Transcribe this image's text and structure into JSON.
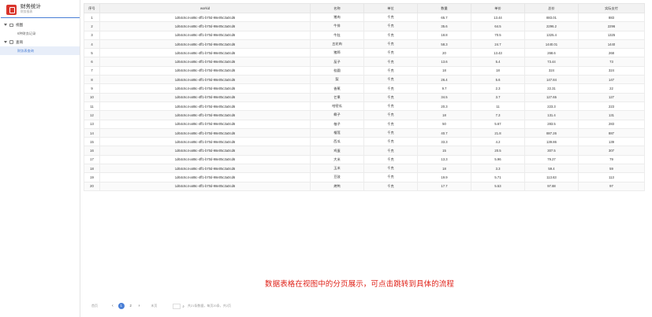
{
  "app": {
    "title": "财务统计",
    "subtitle": "财务报表"
  },
  "sidebar": {
    "items": [
      {
        "label": "视图",
        "level": 1
      },
      {
        "label": "6种财务记录",
        "level": 2
      },
      {
        "label": "查询",
        "level": 1
      },
      {
        "label": "财务表查询",
        "level": 2,
        "active": true
      }
    ]
  },
  "table": {
    "headers": [
      "序号",
      "workid",
      "名称",
      "单位",
      "数量",
      "单价",
      "总价",
      "实际支付"
    ],
    "rows": [
      [
        "1",
        "1d64c6c4-a88c-4ff1-b70d-98e05c3a0cd6",
        "猪肉",
        "千克",
        "65.7",
        "13.44",
        "883.01",
        "883"
      ],
      [
        "2",
        "1d64c6c4-a88c-4ff1-b70d-98e05c3a0cd6",
        "牛排",
        "千克",
        "35.6",
        "64.5",
        "2296.2",
        "2296"
      ],
      [
        "3",
        "1d64c6c4-a88c-4ff1-b70d-98e05c3a0cd6",
        "牛肚",
        "千克",
        "18.8",
        "70.5",
        "1325.4",
        "1325"
      ],
      [
        "4",
        "1d64c6c4-a88c-4ff1-b70d-98e05c3a0cd6",
        "五花肉",
        "千克",
        "58.3",
        "24.7",
        "1440.01",
        "1440"
      ],
      [
        "5",
        "1d64c6c4-a88c-4ff1-b70d-98e05c3a0cd6",
        "猪蹄",
        "千克",
        "20",
        "13.43",
        "268.6",
        "268"
      ],
      [
        "6",
        "1d64c6c4-a88c-4ff1-b70d-98e05c3a0cd6",
        "茄子",
        "千克",
        "13.6",
        "5.4",
        "73.44",
        "73"
      ],
      [
        "7",
        "1d64c6c4-a88c-4ff1-b70d-98e05c3a0cd6",
        "桂圆",
        "千克",
        "18",
        "18",
        "324",
        "324"
      ],
      [
        "8",
        "1d64c6c4-a88c-4ff1-b70d-98e05c3a0cd6",
        "梨",
        "千克",
        "26.4",
        "5.6",
        "147.84",
        "147"
      ],
      [
        "9",
        "1d64c6c4-a88c-4ff1-b70d-98e05c3a0cd6",
        "香蕉",
        "千克",
        "9.7",
        "2.3",
        "22.31",
        "22"
      ],
      [
        "10",
        "1d64c6c4-a88c-4ff1-b70d-98e05c3a0cd6",
        "芒果",
        "千克",
        "34.5",
        "3.7",
        "127.65",
        "127"
      ],
      [
        "11",
        "1d64c6c4-a88c-4ff1-b70d-98e05c3a0cd6",
        "哈密瓜",
        "千克",
        "20.3",
        "11",
        "223.3",
        "223"
      ],
      [
        "12",
        "1d64c6c4-a88c-4ff1-b70d-98e05c3a0cd6",
        "椰子",
        "千克",
        "18",
        "7.3",
        "131.4",
        "131"
      ],
      [
        "13",
        "1d64c6c4-a88c-4ff1-b70d-98e05c3a0cd6",
        "柚子",
        "千克",
        "50",
        "5.67",
        "283.5",
        "283"
      ],
      [
        "14",
        "1d64c6c4-a88c-4ff1-b70d-98e05c3a0cd6",
        "榴莲",
        "千克",
        "40.7",
        "21.8",
        "887.26",
        "887"
      ],
      [
        "15",
        "1d64c6c4-a88c-4ff1-b70d-98e05c3a0cd6",
        "西瓜",
        "千克",
        "33.3",
        "4.2",
        "139.86",
        "139"
      ],
      [
        "16",
        "1d64c6c4-a88c-4ff1-b70d-98e05c3a0cd6",
        "鸡蛋",
        "千克",
        "15",
        "20.5",
        "307.5",
        "307"
      ],
      [
        "17",
        "1d64c6c4-a88c-4ff1-b70d-98e05c3a0cd6",
        "大米",
        "千克",
        "13.3",
        "5.96",
        "79.27",
        "79"
      ],
      [
        "18",
        "1d64c6c4-a88c-4ff1-b70d-98e05c3a0cd6",
        "玉米",
        "千克",
        "18",
        "3.3",
        "59.4",
        "59"
      ],
      [
        "19",
        "1d64c6c4-a88c-4ff1-b70d-98e05c3a0cd6",
        "豆豉",
        "千克",
        "19.9",
        "5.71",
        "113.63",
        "113"
      ],
      [
        "20",
        "1d64c6c4-a88c-4ff1-b70d-98e05c3a0cd6",
        "烤鸭",
        "千克",
        "17.7",
        "5.53",
        "97.88",
        "97"
      ]
    ]
  },
  "annotation": "数据表格在视图中的分页展示，可点击跳转到具体的流程",
  "pager": {
    "first": "首页",
    "pages": [
      "1",
      "2"
    ],
    "current": "1",
    "last": "末页",
    "summary": "共21条数据，每页20条，共2页"
  },
  "colors": {
    "accent": "#4a7fd6",
    "logo": "#d9342b",
    "note": "#e0251c"
  }
}
